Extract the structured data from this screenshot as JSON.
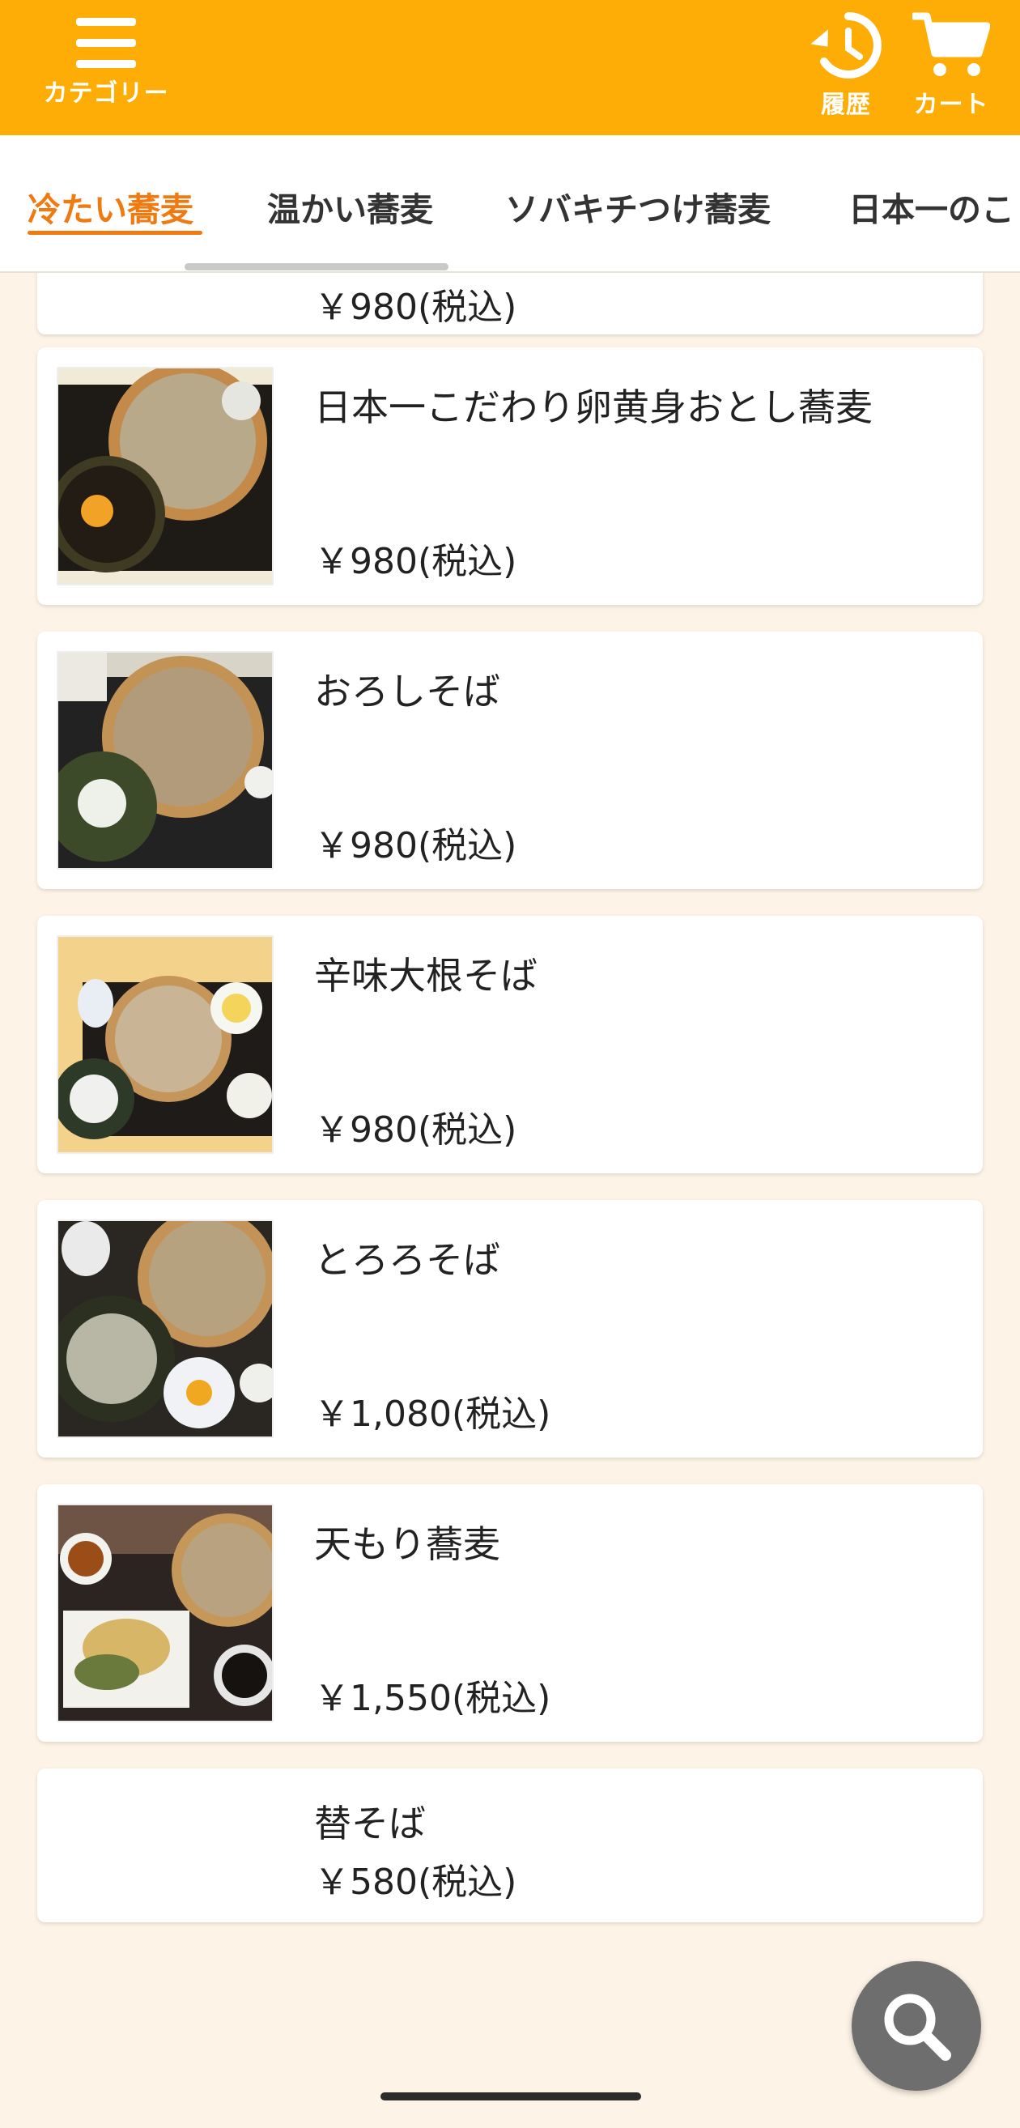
{
  "header": {
    "menu_label": "カテゴリー",
    "history_label": "履歴",
    "cart_label": "カート",
    "bg_color": "#fdad05"
  },
  "tabs": [
    {
      "label": "冷たい蕎麦",
      "active": true
    },
    {
      "label": "温かい蕎麦",
      "active": false
    },
    {
      "label": "ソバキチつけ蕎麦",
      "active": false
    },
    {
      "label": "日本一のこ",
      "active": false
    }
  ],
  "accent_color": "#f07a10",
  "items": [
    {
      "name": "",
      "price": "￥980(税込)"
    },
    {
      "name": "日本一こだわり卵黄身おとし蕎麦",
      "price": "￥980(税込)"
    },
    {
      "name": "おろしそば",
      "price": "￥980(税込)"
    },
    {
      "name": "辛味大根そば",
      "price": "￥980(税込)"
    },
    {
      "name": "とろろそば",
      "price": "￥1,080(税込)"
    },
    {
      "name": "天もり蕎麦",
      "price": "￥1,550(税込)"
    },
    {
      "name": "替そば",
      "price": "￥580(税込)"
    }
  ],
  "icons": {
    "menu": "hamburger-icon",
    "history": "history-icon",
    "cart": "cart-icon",
    "search": "search-icon"
  }
}
